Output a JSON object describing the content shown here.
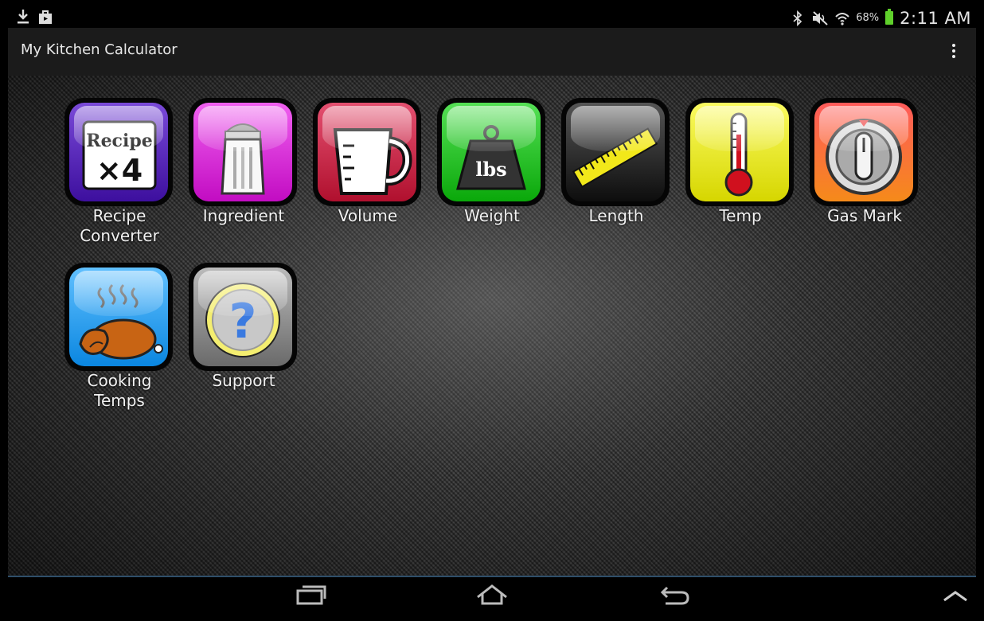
{
  "status_bar": {
    "icons_left": [
      "download-icon",
      "store-bag-icon"
    ],
    "icons_right": [
      "bluetooth-icon",
      "mute-icon",
      "wifi-icon"
    ],
    "battery": "68%",
    "battery_color": "#5fd02b",
    "time": "2:11 AM"
  },
  "action_bar": {
    "title": "My Kitchen Calculator",
    "overflow_icon": "overflow-menu-icon"
  },
  "tiles": [
    {
      "label": "Recipe\nConverter",
      "icon": "recipe-x4-icon",
      "color": "#5a1fbf",
      "icon_text_1": "Recipe",
      "icon_text_2": "×4"
    },
    {
      "label": "Ingredient",
      "icon": "salt-shaker-icon",
      "color": "#d620d6"
    },
    {
      "label": "Volume",
      "icon": "measuring-cup-icon",
      "color": "#c8213f"
    },
    {
      "label": "Weight",
      "icon": "weight-icon",
      "color": "#19c219",
      "icon_text_1": "lbs"
    },
    {
      "label": "Length",
      "icon": "ruler-icon",
      "color": "#333333"
    },
    {
      "label": "Temp",
      "icon": "thermometer-icon",
      "color": "#e8e814"
    },
    {
      "label": "Gas Mark",
      "icon": "gas-dial-icon",
      "color": "#f07a1e"
    },
    {
      "label": "Cooking\nTemps",
      "icon": "roast-chicken-icon",
      "color": "#1c9bef"
    },
    {
      "label": "Support",
      "icon": "question-icon",
      "color": "#8a8a8a"
    }
  ],
  "nav_bar": {
    "buttons": [
      "recent-apps-icon",
      "home-icon",
      "back-icon",
      "up-arrow-icon"
    ]
  }
}
